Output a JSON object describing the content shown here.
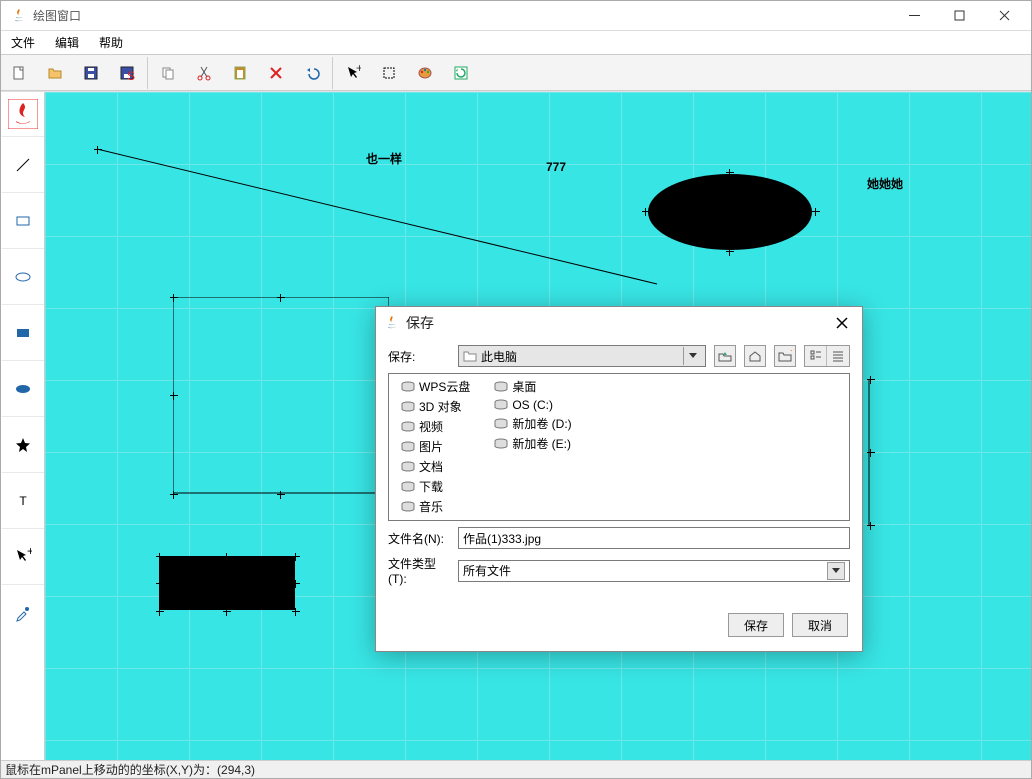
{
  "window": {
    "title": "绘图窗口"
  },
  "menu": {
    "file": "文件",
    "edit": "编辑",
    "help": "帮助"
  },
  "canvas_labels": {
    "a": "也一样",
    "b": "777",
    "c": "她她她"
  },
  "dialog": {
    "title": "保存",
    "save_in_label": "保存:",
    "location": "此电脑",
    "filename_label": "文件名(N):",
    "filename": "作品(1)333.jpg",
    "filetype_label": "文件类型(T):",
    "filetype": "所有文件",
    "save_btn": "保存",
    "cancel_btn": "取消"
  },
  "files": {
    "col1": [
      "WPS云盘",
      "3D 对象",
      "视频",
      "图片",
      "文档",
      "下载",
      "音乐"
    ],
    "col2": [
      "桌面",
      "OS (C:)",
      "新加卷 (D:)",
      "新加卷 (E:)"
    ]
  },
  "status": "鼠标在mPanel上移动的的坐标(X,Y)为：(294,3)"
}
